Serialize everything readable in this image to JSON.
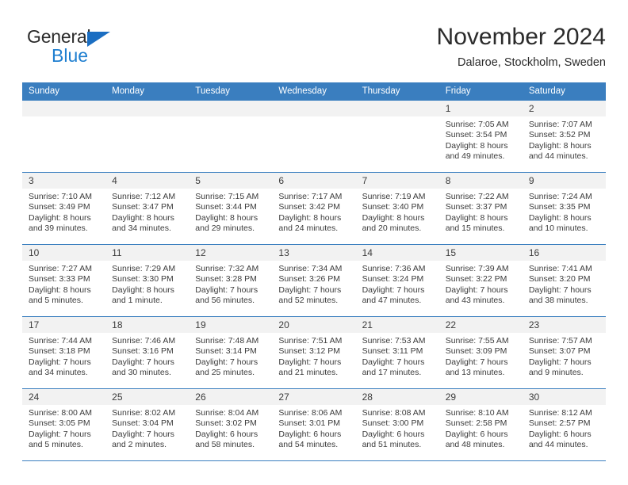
{
  "brand": {
    "name_part1": "General",
    "name_part2": "Blue",
    "color_dark": "#2b2b2b",
    "color_blue": "#1f7fd0",
    "triangle_color": "#1b6ec2"
  },
  "header": {
    "title": "November 2024",
    "subtitle": "Dalaroe, Stockholm, Sweden"
  },
  "theme": {
    "header_row_bg": "#3a7ebf",
    "header_row_text": "#ffffff",
    "daynum_band_bg": "#f2f2f2",
    "cell_border": "#3a7ebf",
    "body_text": "#3b3b3b"
  },
  "weekdays": [
    "Sunday",
    "Monday",
    "Tuesday",
    "Wednesday",
    "Thursday",
    "Friday",
    "Saturday"
  ],
  "weeks": [
    [
      {
        "day": "",
        "empty": true
      },
      {
        "day": "",
        "empty": true
      },
      {
        "day": "",
        "empty": true
      },
      {
        "day": "",
        "empty": true
      },
      {
        "day": "",
        "empty": true
      },
      {
        "day": "1",
        "sunrise": "Sunrise: 7:05 AM",
        "sunset": "Sunset: 3:54 PM",
        "daylight1": "Daylight: 8 hours",
        "daylight2": "and 49 minutes."
      },
      {
        "day": "2",
        "sunrise": "Sunrise: 7:07 AM",
        "sunset": "Sunset: 3:52 PM",
        "daylight1": "Daylight: 8 hours",
        "daylight2": "and 44 minutes."
      }
    ],
    [
      {
        "day": "3",
        "sunrise": "Sunrise: 7:10 AM",
        "sunset": "Sunset: 3:49 PM",
        "daylight1": "Daylight: 8 hours",
        "daylight2": "and 39 minutes."
      },
      {
        "day": "4",
        "sunrise": "Sunrise: 7:12 AM",
        "sunset": "Sunset: 3:47 PM",
        "daylight1": "Daylight: 8 hours",
        "daylight2": "and 34 minutes."
      },
      {
        "day": "5",
        "sunrise": "Sunrise: 7:15 AM",
        "sunset": "Sunset: 3:44 PM",
        "daylight1": "Daylight: 8 hours",
        "daylight2": "and 29 minutes."
      },
      {
        "day": "6",
        "sunrise": "Sunrise: 7:17 AM",
        "sunset": "Sunset: 3:42 PM",
        "daylight1": "Daylight: 8 hours",
        "daylight2": "and 24 minutes."
      },
      {
        "day": "7",
        "sunrise": "Sunrise: 7:19 AM",
        "sunset": "Sunset: 3:40 PM",
        "daylight1": "Daylight: 8 hours",
        "daylight2": "and 20 minutes."
      },
      {
        "day": "8",
        "sunrise": "Sunrise: 7:22 AM",
        "sunset": "Sunset: 3:37 PM",
        "daylight1": "Daylight: 8 hours",
        "daylight2": "and 15 minutes."
      },
      {
        "day": "9",
        "sunrise": "Sunrise: 7:24 AM",
        "sunset": "Sunset: 3:35 PM",
        "daylight1": "Daylight: 8 hours",
        "daylight2": "and 10 minutes."
      }
    ],
    [
      {
        "day": "10",
        "sunrise": "Sunrise: 7:27 AM",
        "sunset": "Sunset: 3:33 PM",
        "daylight1": "Daylight: 8 hours",
        "daylight2": "and 5 minutes."
      },
      {
        "day": "11",
        "sunrise": "Sunrise: 7:29 AM",
        "sunset": "Sunset: 3:30 PM",
        "daylight1": "Daylight: 8 hours",
        "daylight2": "and 1 minute."
      },
      {
        "day": "12",
        "sunrise": "Sunrise: 7:32 AM",
        "sunset": "Sunset: 3:28 PM",
        "daylight1": "Daylight: 7 hours",
        "daylight2": "and 56 minutes."
      },
      {
        "day": "13",
        "sunrise": "Sunrise: 7:34 AM",
        "sunset": "Sunset: 3:26 PM",
        "daylight1": "Daylight: 7 hours",
        "daylight2": "and 52 minutes."
      },
      {
        "day": "14",
        "sunrise": "Sunrise: 7:36 AM",
        "sunset": "Sunset: 3:24 PM",
        "daylight1": "Daylight: 7 hours",
        "daylight2": "and 47 minutes."
      },
      {
        "day": "15",
        "sunrise": "Sunrise: 7:39 AM",
        "sunset": "Sunset: 3:22 PM",
        "daylight1": "Daylight: 7 hours",
        "daylight2": "and 43 minutes."
      },
      {
        "day": "16",
        "sunrise": "Sunrise: 7:41 AM",
        "sunset": "Sunset: 3:20 PM",
        "daylight1": "Daylight: 7 hours",
        "daylight2": "and 38 minutes."
      }
    ],
    [
      {
        "day": "17",
        "sunrise": "Sunrise: 7:44 AM",
        "sunset": "Sunset: 3:18 PM",
        "daylight1": "Daylight: 7 hours",
        "daylight2": "and 34 minutes."
      },
      {
        "day": "18",
        "sunrise": "Sunrise: 7:46 AM",
        "sunset": "Sunset: 3:16 PM",
        "daylight1": "Daylight: 7 hours",
        "daylight2": "and 30 minutes."
      },
      {
        "day": "19",
        "sunrise": "Sunrise: 7:48 AM",
        "sunset": "Sunset: 3:14 PM",
        "daylight1": "Daylight: 7 hours",
        "daylight2": "and 25 minutes."
      },
      {
        "day": "20",
        "sunrise": "Sunrise: 7:51 AM",
        "sunset": "Sunset: 3:12 PM",
        "daylight1": "Daylight: 7 hours",
        "daylight2": "and 21 minutes."
      },
      {
        "day": "21",
        "sunrise": "Sunrise: 7:53 AM",
        "sunset": "Sunset: 3:11 PM",
        "daylight1": "Daylight: 7 hours",
        "daylight2": "and 17 minutes."
      },
      {
        "day": "22",
        "sunrise": "Sunrise: 7:55 AM",
        "sunset": "Sunset: 3:09 PM",
        "daylight1": "Daylight: 7 hours",
        "daylight2": "and 13 minutes."
      },
      {
        "day": "23",
        "sunrise": "Sunrise: 7:57 AM",
        "sunset": "Sunset: 3:07 PM",
        "daylight1": "Daylight: 7 hours",
        "daylight2": "and 9 minutes."
      }
    ],
    [
      {
        "day": "24",
        "sunrise": "Sunrise: 8:00 AM",
        "sunset": "Sunset: 3:05 PM",
        "daylight1": "Daylight: 7 hours",
        "daylight2": "and 5 minutes."
      },
      {
        "day": "25",
        "sunrise": "Sunrise: 8:02 AM",
        "sunset": "Sunset: 3:04 PM",
        "daylight1": "Daylight: 7 hours",
        "daylight2": "and 2 minutes."
      },
      {
        "day": "26",
        "sunrise": "Sunrise: 8:04 AM",
        "sunset": "Sunset: 3:02 PM",
        "daylight1": "Daylight: 6 hours",
        "daylight2": "and 58 minutes."
      },
      {
        "day": "27",
        "sunrise": "Sunrise: 8:06 AM",
        "sunset": "Sunset: 3:01 PM",
        "daylight1": "Daylight: 6 hours",
        "daylight2": "and 54 minutes."
      },
      {
        "day": "28",
        "sunrise": "Sunrise: 8:08 AM",
        "sunset": "Sunset: 3:00 PM",
        "daylight1": "Daylight: 6 hours",
        "daylight2": "and 51 minutes."
      },
      {
        "day": "29",
        "sunrise": "Sunrise: 8:10 AM",
        "sunset": "Sunset: 2:58 PM",
        "daylight1": "Daylight: 6 hours",
        "daylight2": "and 48 minutes."
      },
      {
        "day": "30",
        "sunrise": "Sunrise: 8:12 AM",
        "sunset": "Sunset: 2:57 PM",
        "daylight1": "Daylight: 6 hours",
        "daylight2": "and 44 minutes."
      }
    ]
  ]
}
